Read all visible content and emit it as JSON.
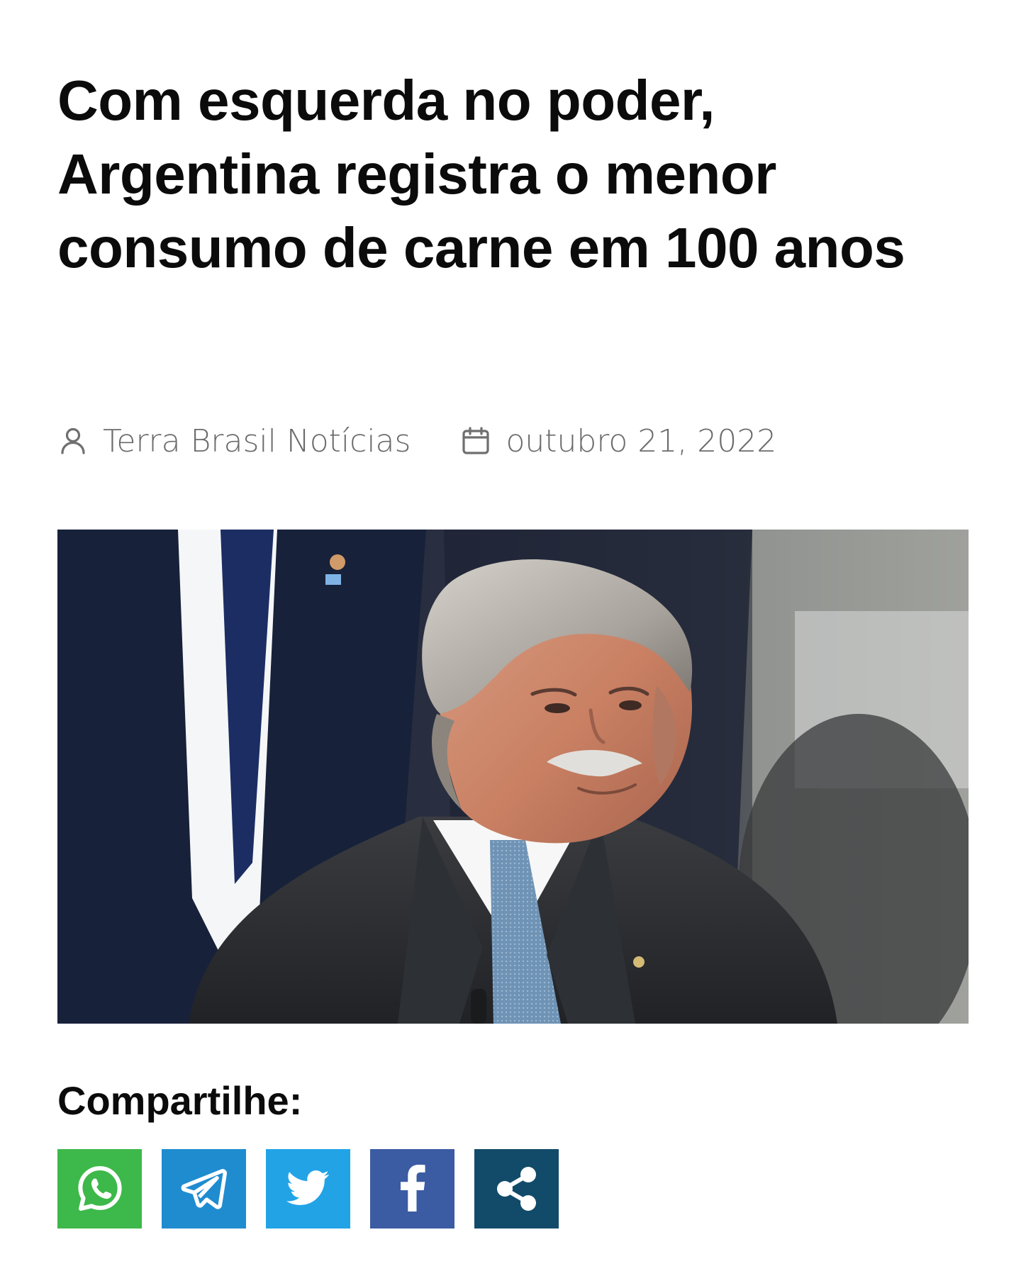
{
  "article": {
    "headline": "Com esquerda no poder, Argentina registra o menor consumo de carne em 100 anos",
    "author": "Terra Brasil Notícias",
    "date": "outubro 21, 2022",
    "author_icon": "user-icon",
    "date_icon": "calendar-icon"
  },
  "photo": {
    "subject": "man-portrait"
  },
  "share": {
    "heading": "Compartilhe:",
    "buttons": [
      {
        "name": "whatsapp",
        "icon": "whatsapp-icon",
        "color": "#3db84a"
      },
      {
        "name": "telegram",
        "icon": "telegram-icon",
        "color": "#1f8cd0"
      },
      {
        "name": "twitter",
        "icon": "twitter-icon",
        "color": "#22a3e6"
      },
      {
        "name": "facebook",
        "icon": "facebook-icon",
        "color": "#3b5ba3"
      },
      {
        "name": "share",
        "icon": "share-icon",
        "color": "#124b6a"
      }
    ]
  }
}
